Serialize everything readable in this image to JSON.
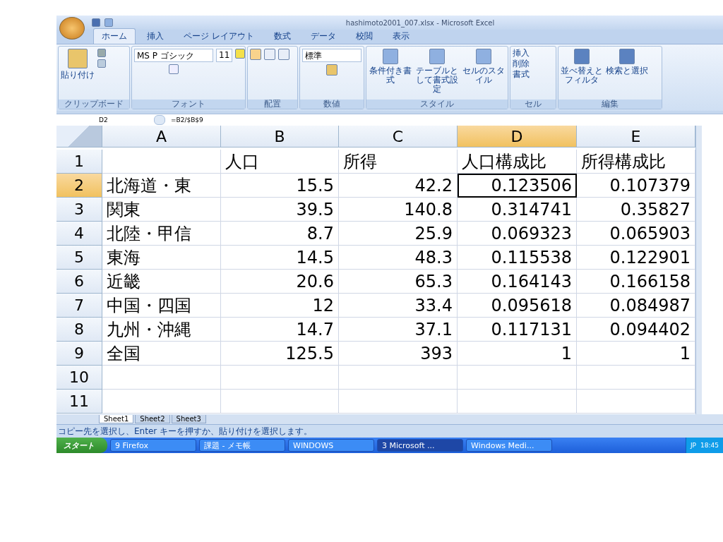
{
  "window": {
    "title": "hashimoto2001_007.xlsx - Microsoft Excel"
  },
  "tabs": [
    {
      "label": "ホーム",
      "selected": true
    },
    {
      "label": "挿入",
      "selected": false
    },
    {
      "label": "ページ レイアウト",
      "selected": false
    },
    {
      "label": "数式",
      "selected": false
    },
    {
      "label": "データ",
      "selected": false
    },
    {
      "label": "校閲",
      "selected": false
    },
    {
      "label": "表示",
      "selected": false
    }
  ],
  "ribbon": {
    "paste": "貼り付け",
    "font_name": "MS P ゴシック",
    "font_size": "11",
    "number_format": "標準",
    "styles": [
      {
        "label": "条件付き書式"
      },
      {
        "label": "テーブルとして書式設定"
      },
      {
        "label": "セルのスタイル"
      }
    ],
    "cells": [
      {
        "label": "挿入"
      },
      {
        "label": "削除"
      },
      {
        "label": "書式"
      }
    ],
    "editing": [
      {
        "label": "並べ替えとフィルタ"
      },
      {
        "label": "検索と選択"
      }
    ],
    "groups": [
      "クリップボード",
      "フォント",
      "配置",
      "数値",
      "スタイル",
      "セル",
      "編集"
    ]
  },
  "formula_bar": {
    "name_box": "D2",
    "formula": "=B2/$B$9"
  },
  "sheet": {
    "columns": [
      {
        "label": "A",
        "selected": false
      },
      {
        "label": "B",
        "selected": false
      },
      {
        "label": "C",
        "selected": false
      },
      {
        "label": "D",
        "selected": true
      },
      {
        "label": "E",
        "selected": false
      }
    ],
    "rows": [
      {
        "label": "1",
        "selected": false,
        "cells": [
          {
            "kind": "empty"
          },
          {
            "text": "人口",
            "kind": "text"
          },
          {
            "text": "所得",
            "kind": "text"
          },
          {
            "text": "人口構成比",
            "kind": "text"
          },
          {
            "text": "所得構成比",
            "kind": "text"
          }
        ]
      },
      {
        "label": "2",
        "selected": true,
        "cells": [
          {
            "text": "北海道・東",
            "kind": "text"
          },
          {
            "text": "15.5",
            "kind": "number"
          },
          {
            "text": "42.2",
            "kind": "number"
          },
          {
            "text": "0.123506",
            "kind": "number"
          },
          {
            "text": "0.107379",
            "kind": "number"
          }
        ]
      },
      {
        "label": "3",
        "selected": false,
        "cells": [
          {
            "text": "関東",
            "kind": "text"
          },
          {
            "text": "39.5",
            "kind": "number"
          },
          {
            "text": "140.8",
            "kind": "number"
          },
          {
            "text": "0.314741",
            "kind": "number"
          },
          {
            "text": "0.35827",
            "kind": "number"
          }
        ]
      },
      {
        "label": "4",
        "selected": false,
        "cells": [
          {
            "text": "北陸・甲信",
            "kind": "text"
          },
          {
            "text": "8.7",
            "kind": "number"
          },
          {
            "text": "25.9",
            "kind": "number"
          },
          {
            "text": "0.069323",
            "kind": "number"
          },
          {
            "text": "0.065903",
            "kind": "number"
          }
        ]
      },
      {
        "label": "5",
        "selected": false,
        "cells": [
          {
            "text": "東海",
            "kind": "text"
          },
          {
            "text": "14.5",
            "kind": "number"
          },
          {
            "text": "48.3",
            "kind": "number"
          },
          {
            "text": "0.115538",
            "kind": "number"
          },
          {
            "text": "0.122901",
            "kind": "number"
          }
        ]
      },
      {
        "label": "6",
        "selected": false,
        "cells": [
          {
            "text": "近畿",
            "kind": "text"
          },
          {
            "text": "20.6",
            "kind": "number"
          },
          {
            "text": "65.3",
            "kind": "number"
          },
          {
            "text": "0.164143",
            "kind": "number"
          },
          {
            "text": "0.166158",
            "kind": "number"
          }
        ]
      },
      {
        "label": "7",
        "selected": false,
        "cells": [
          {
            "text": "中国・四国",
            "kind": "text"
          },
          {
            "text": "12",
            "kind": "number"
          },
          {
            "text": "33.4",
            "kind": "number"
          },
          {
            "text": "0.095618",
            "kind": "number"
          },
          {
            "text": "0.084987",
            "kind": "number"
          }
        ]
      },
      {
        "label": "8",
        "selected": false,
        "cells": [
          {
            "text": "九州・沖縄",
            "kind": "text"
          },
          {
            "text": "14.7",
            "kind": "number"
          },
          {
            "text": "37.1",
            "kind": "number"
          },
          {
            "text": "0.117131",
            "kind": "number"
          },
          {
            "text": "0.094402",
            "kind": "number"
          }
        ]
      },
      {
        "label": "9",
        "selected": false,
        "cells": [
          {
            "text": "全国",
            "kind": "text"
          },
          {
            "text": "125.5",
            "kind": "number"
          },
          {
            "text": "393",
            "kind": "number"
          },
          {
            "text": "1",
            "kind": "number"
          },
          {
            "text": "1",
            "kind": "number"
          }
        ]
      },
      {
        "label": "10",
        "selected": false
      },
      {
        "label": "11",
        "selected": false
      }
    ]
  },
  "sheet_tabs": [
    {
      "label": "Sheet1",
      "selected": true
    },
    {
      "label": "Sheet2",
      "selected": false
    },
    {
      "label": "Sheet3",
      "selected": false
    }
  ],
  "status_bar": {
    "message": "コピー先を選択し、Enter キーを押すか、貼り付けを選択します。"
  },
  "taskbar": {
    "start": "スタート",
    "items": [
      {
        "label": "9 Firefox",
        "selected": false
      },
      {
        "label": "課題 - メモ帳",
        "selected": false
      },
      {
        "label": "WINDOWS",
        "selected": false
      },
      {
        "label": "3 Microsoft ...",
        "selected": true
      },
      {
        "label": "Windows Medi...",
        "selected": false
      }
    ],
    "language": "JP",
    "clock": "18:45"
  }
}
